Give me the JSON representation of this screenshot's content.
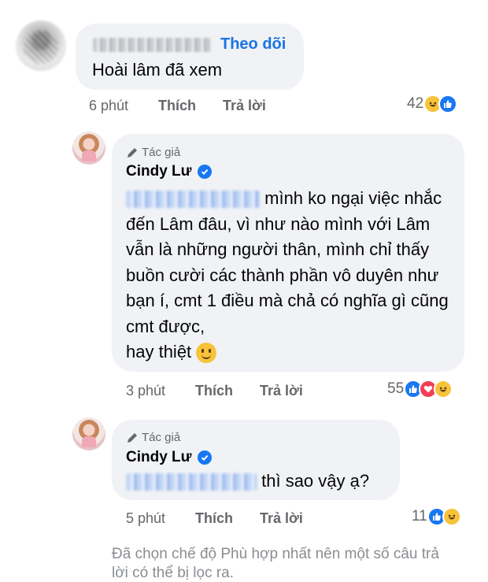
{
  "comment1": {
    "follow_label": "Theo dõi",
    "text": "Hoài lâm đã xem",
    "time": "6 phút",
    "like_label": "Thích",
    "reply_label": "Trả lời",
    "reaction_count": "42",
    "reactions": [
      "haha-emoji",
      "like-emoji"
    ]
  },
  "reply1": {
    "author_tag": "Tác giả",
    "author": "Cindy Lư",
    "text_line1": "mình ko ngại việc",
    "text_rest": "nhắc đến Lâm đâu, vì như nào mình với Lâm vẫn là những người thân, mình chỉ thấy buồn cười các thành phần vô duyên như bạn í, cmt 1 điều mà chả có nghĩa gì cũng cmt được,",
    "text_last": "hay thiệt",
    "time": "3 phút",
    "like_label": "Thích",
    "reply_label": "Trả lời",
    "reaction_count": "55",
    "reactions": [
      "like-emoji",
      "love-emoji",
      "haha-emoji"
    ]
  },
  "reply2": {
    "author_tag": "Tác giả",
    "author": "Cindy Lư",
    "text": "thì sao vậy ạ?",
    "time": "5 phút",
    "like_label": "Thích",
    "reply_label": "Trả lời",
    "reaction_count": "11",
    "reactions": [
      "like-emoji",
      "haha-emoji"
    ]
  },
  "filter_note": "Đã chọn chế độ Phù hợp nhất nên một số câu trả lời có thể bị lọc ra."
}
